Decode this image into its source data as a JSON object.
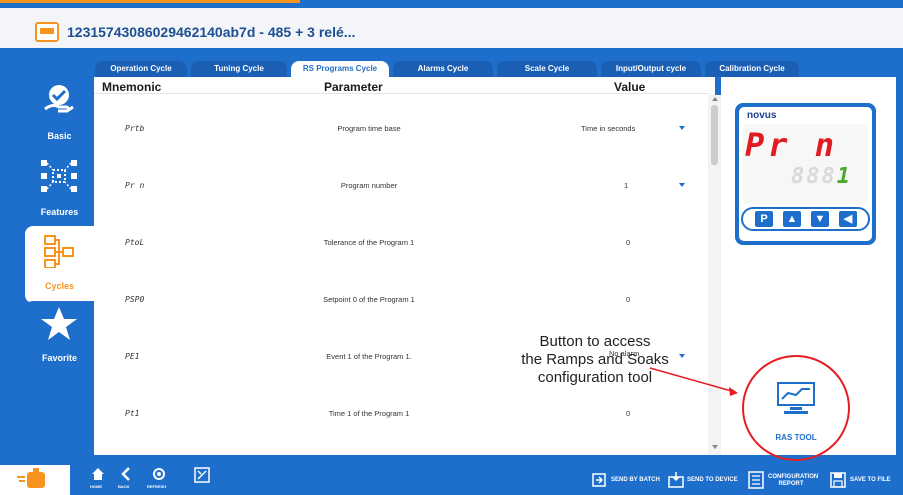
{
  "device": {
    "title": "12315743086029462140ab7d - 485 + 3 relé..."
  },
  "tabs": [
    {
      "label": "Operation Cycle"
    },
    {
      "label": "Tuning Cycle"
    },
    {
      "label": "RS Programs Cycle"
    },
    {
      "label": "Alarms Cycle"
    },
    {
      "label": "Scale Cycle"
    },
    {
      "label": "Input/Output cycle"
    },
    {
      "label": "Calibration Cycle"
    }
  ],
  "active_tab": "RS Programs Cycle",
  "sidebar": {
    "items": [
      {
        "label": "Basic",
        "icon": "hand-check-icon"
      },
      {
        "label": "Features",
        "icon": "network-icon"
      },
      {
        "label": "Cycles",
        "icon": "cycles-icon"
      },
      {
        "label": "Favorite",
        "icon": "star-icon"
      }
    ],
    "active": "Cycles"
  },
  "table": {
    "headers": {
      "mnemonic": "Mnemonic",
      "parameter": "Parameter",
      "value": "Value"
    },
    "rows": [
      {
        "mnemonic": "Prtb",
        "parameter": "Program time base",
        "value": "Time in seconds",
        "dropdown": true
      },
      {
        "mnemonic": "Pr n",
        "parameter": "Program number",
        "value": "1",
        "dropdown": true
      },
      {
        "mnemonic": "PtoL",
        "parameter": "Tolerance of the Program 1",
        "value": "0",
        "dropdown": false
      },
      {
        "mnemonic": "PSP0",
        "parameter": "Setpoint 0 of the Program 1",
        "value": "0",
        "dropdown": false
      },
      {
        "mnemonic": "PE1",
        "parameter": "Event 1 of the Program 1.",
        "value": "No alarm",
        "dropdown": true
      },
      {
        "mnemonic": "Pt1",
        "parameter": "Time 1 of the Program 1",
        "value": "0",
        "dropdown": false
      }
    ]
  },
  "display": {
    "brand": "novus",
    "main": "Pr n",
    "secondary_dim": "888",
    "secondary_lit": "1",
    "keys": [
      "P",
      "▲",
      "▼",
      "◀"
    ]
  },
  "annotation": {
    "lines": [
      "Button to access",
      "the Ramps and Soaks",
      "configuration tool"
    ]
  },
  "ras_tool": {
    "label": "RAS TOOL",
    "icon": "monitor-chart-icon"
  },
  "bottom": {
    "nav_icons": [
      "home-icon",
      "back-icon",
      "refresh-icon",
      "settings-icon"
    ],
    "nav_labels": [
      "HOME",
      "BACK",
      "REFRESH",
      ""
    ],
    "actions": [
      {
        "label": "SEND BY BATCH",
        "icon": "send-batch-icon"
      },
      {
        "label": "SEND TO DEVICE",
        "icon": "send-device-icon"
      },
      {
        "label": "CONFIGURATION REPORT",
        "icon": "report-icon"
      },
      {
        "label": "SAVE TO FILE",
        "icon": "save-icon"
      }
    ]
  },
  "colors": {
    "primary": "#1e6fcc",
    "accent": "#f7941d",
    "highlight": "#e31e24",
    "display_red": "#e11b22",
    "display_green": "#4aa82a"
  }
}
